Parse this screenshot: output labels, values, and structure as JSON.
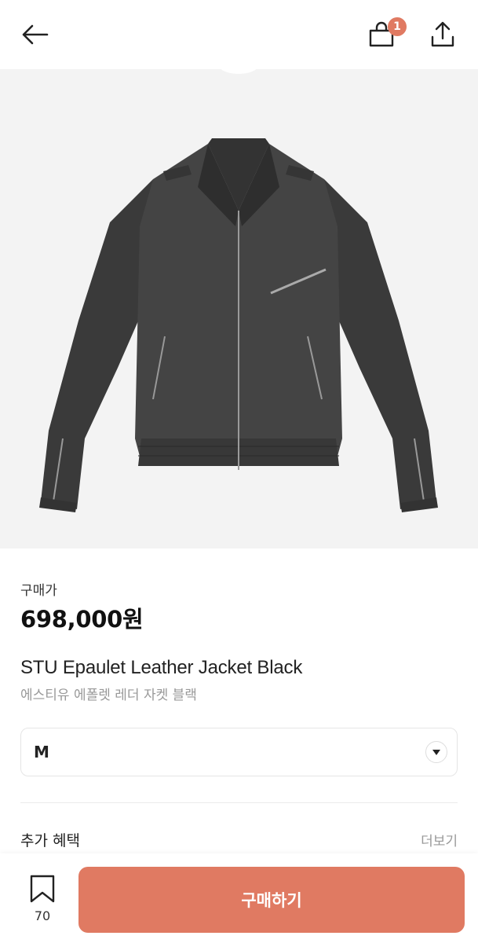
{
  "header": {
    "back_icon": "arrow-left-icon",
    "bag_icon": "shopping-bag-icon",
    "cart_count": "1",
    "share_icon": "share-upload-icon"
  },
  "product": {
    "image_icon": "leather-jacket-image",
    "price_label": "구매가",
    "price": "698,000원",
    "title_en": "STU Epaulet Leather Jacket Black",
    "title_ko": "에스티유 에폴렛 레더 자켓 블랙"
  },
  "size_select": {
    "value": "M",
    "icon": "chevron-down-icon"
  },
  "benefits": {
    "label": "추가 혜택",
    "more": "더보기"
  },
  "bottom": {
    "wish_icon": "bookmark-icon",
    "wish_count": "70",
    "buy_label": "구매하기"
  },
  "colors": {
    "accent": "#e07a62",
    "image_bg": "#f3f3f3"
  }
}
